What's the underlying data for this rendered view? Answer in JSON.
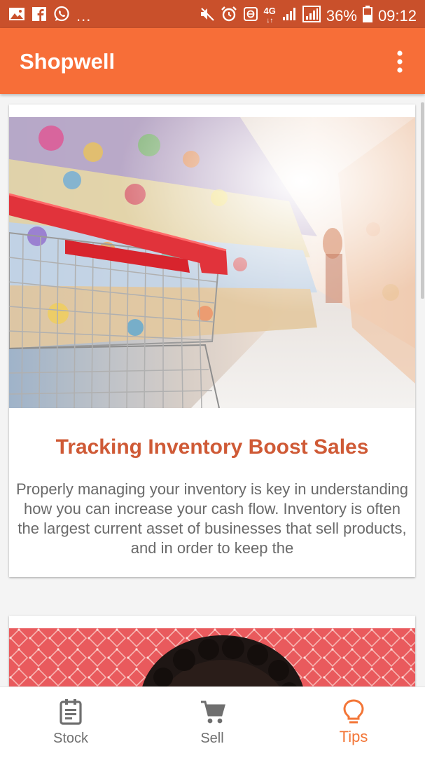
{
  "status_bar": {
    "left_overflow": "...",
    "network": "4G",
    "battery": "36%",
    "time": "09:12",
    "icons": [
      "gallery-icon",
      "facebook-icon",
      "whatsapp-icon",
      "mute-icon",
      "alarm-icon",
      "data-saver-icon",
      "signal-icon",
      "signal-icon",
      "battery-icon"
    ]
  },
  "app_bar": {
    "title": "Shopwell",
    "menu_icon": "more-vert-icon",
    "background": "#f76e38"
  },
  "tips": [
    {
      "image": "shopping-cart-in-supermarket-aisle-photo",
      "title": "Tracking Inventory Boost Sales",
      "body": "Properly managing your inventory is key in understanding how you can increase your cash flow. Inventory is often the largest current asset of businesses that sell products, and in order to keep the"
    },
    {
      "image": "person-against-red-patterned-background-photo"
    }
  ],
  "bottom_nav": {
    "items": [
      {
        "label": "Stock",
        "icon": "clipboard-icon"
      },
      {
        "label": "Sell",
        "icon": "cart-icon"
      },
      {
        "label": "Tips",
        "icon": "lightbulb-icon",
        "active": true
      }
    ],
    "active_color": "#f37536",
    "inactive_color": "#6f6f6f"
  }
}
